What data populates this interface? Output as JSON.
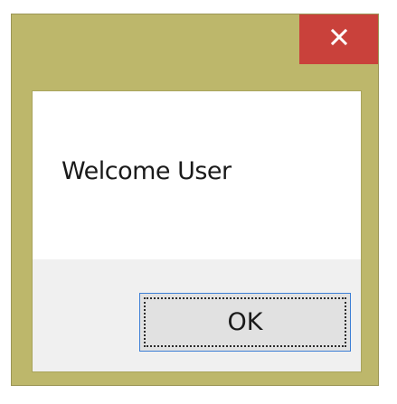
{
  "dialog": {
    "title": "",
    "message": "Welcome User",
    "ok_label": "OK",
    "close_icon": "close-icon"
  },
  "colors": {
    "frame": "#bdb76b",
    "close_button": "#c9413b",
    "client_background": "#ffffff",
    "button_area": "#f0f0f0",
    "button_face": "#e1e1e1",
    "button_focus_border": "#3c7fd6"
  }
}
